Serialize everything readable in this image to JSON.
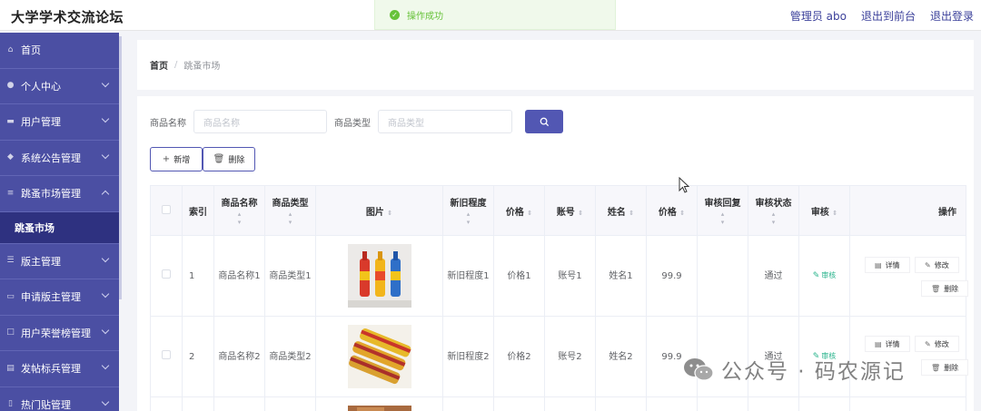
{
  "header": {
    "title": "大学学术交流论坛",
    "admin": "管理员 abo",
    "to_front": "退出到前台",
    "logout": "退出登录"
  },
  "toast": {
    "message": "操作成功"
  },
  "sidebar": {
    "items": [
      {
        "label": "首页",
        "icon": "home-icon"
      },
      {
        "label": "个人中心",
        "icon": "user-icon"
      },
      {
        "label": "用户管理",
        "icon": "briefcase-icon"
      },
      {
        "label": "系统公告管理",
        "icon": "pin-icon"
      },
      {
        "label": "跳蚤市场管理",
        "icon": "list-icon"
      },
      {
        "label": "版主管理",
        "icon": "sliders-icon"
      },
      {
        "label": "申请版主管理",
        "icon": "card-icon"
      },
      {
        "label": "用户荣誉榜管理",
        "icon": "frame-icon"
      },
      {
        "label": "发帖标兵管理",
        "icon": "tag-icon"
      },
      {
        "label": "热门贴管理",
        "icon": "doc-icon"
      }
    ],
    "active_sub": "跳蚤市场"
  },
  "breadcrumb": {
    "home": "首页",
    "separator": "/",
    "current": "跳蚤市场"
  },
  "search": {
    "name_label": "商品名称",
    "name_placeholder": "商品名称",
    "type_label": "商品类型",
    "type_placeholder": "商品类型"
  },
  "actions": {
    "add": "新增",
    "delete": "删除"
  },
  "table": {
    "columns": [
      "索引",
      "商品名称",
      "商品类型",
      "图片",
      "新旧程度",
      "价格",
      "账号",
      "姓名",
      "价格",
      "审核回复",
      "审核状态",
      "审核",
      "操作"
    ],
    "rows": [
      {
        "index": "1",
        "name": "商品名称1",
        "type": "商品类型1",
        "condition": "新旧程度1",
        "price_text": "价格1",
        "account": "账号1",
        "person": "姓名1",
        "price": "99.9",
        "reply": "",
        "status": "通过",
        "review": "审核"
      },
      {
        "index": "2",
        "name": "商品名称2",
        "type": "商品类型2",
        "condition": "新旧程度2",
        "price_text": "价格2",
        "account": "账号2",
        "person": "姓名2",
        "price": "99.9",
        "reply": "",
        "status": "通过",
        "review": "审核"
      }
    ],
    "row_actions": {
      "detail": "详情",
      "edit": "修改",
      "delete": "删除"
    }
  },
  "watermark": {
    "text": "公众号 · 码农源记"
  },
  "colors": {
    "sidebar": "#4b4fa3",
    "accent": "#5257b3",
    "success": "#27b38b"
  }
}
